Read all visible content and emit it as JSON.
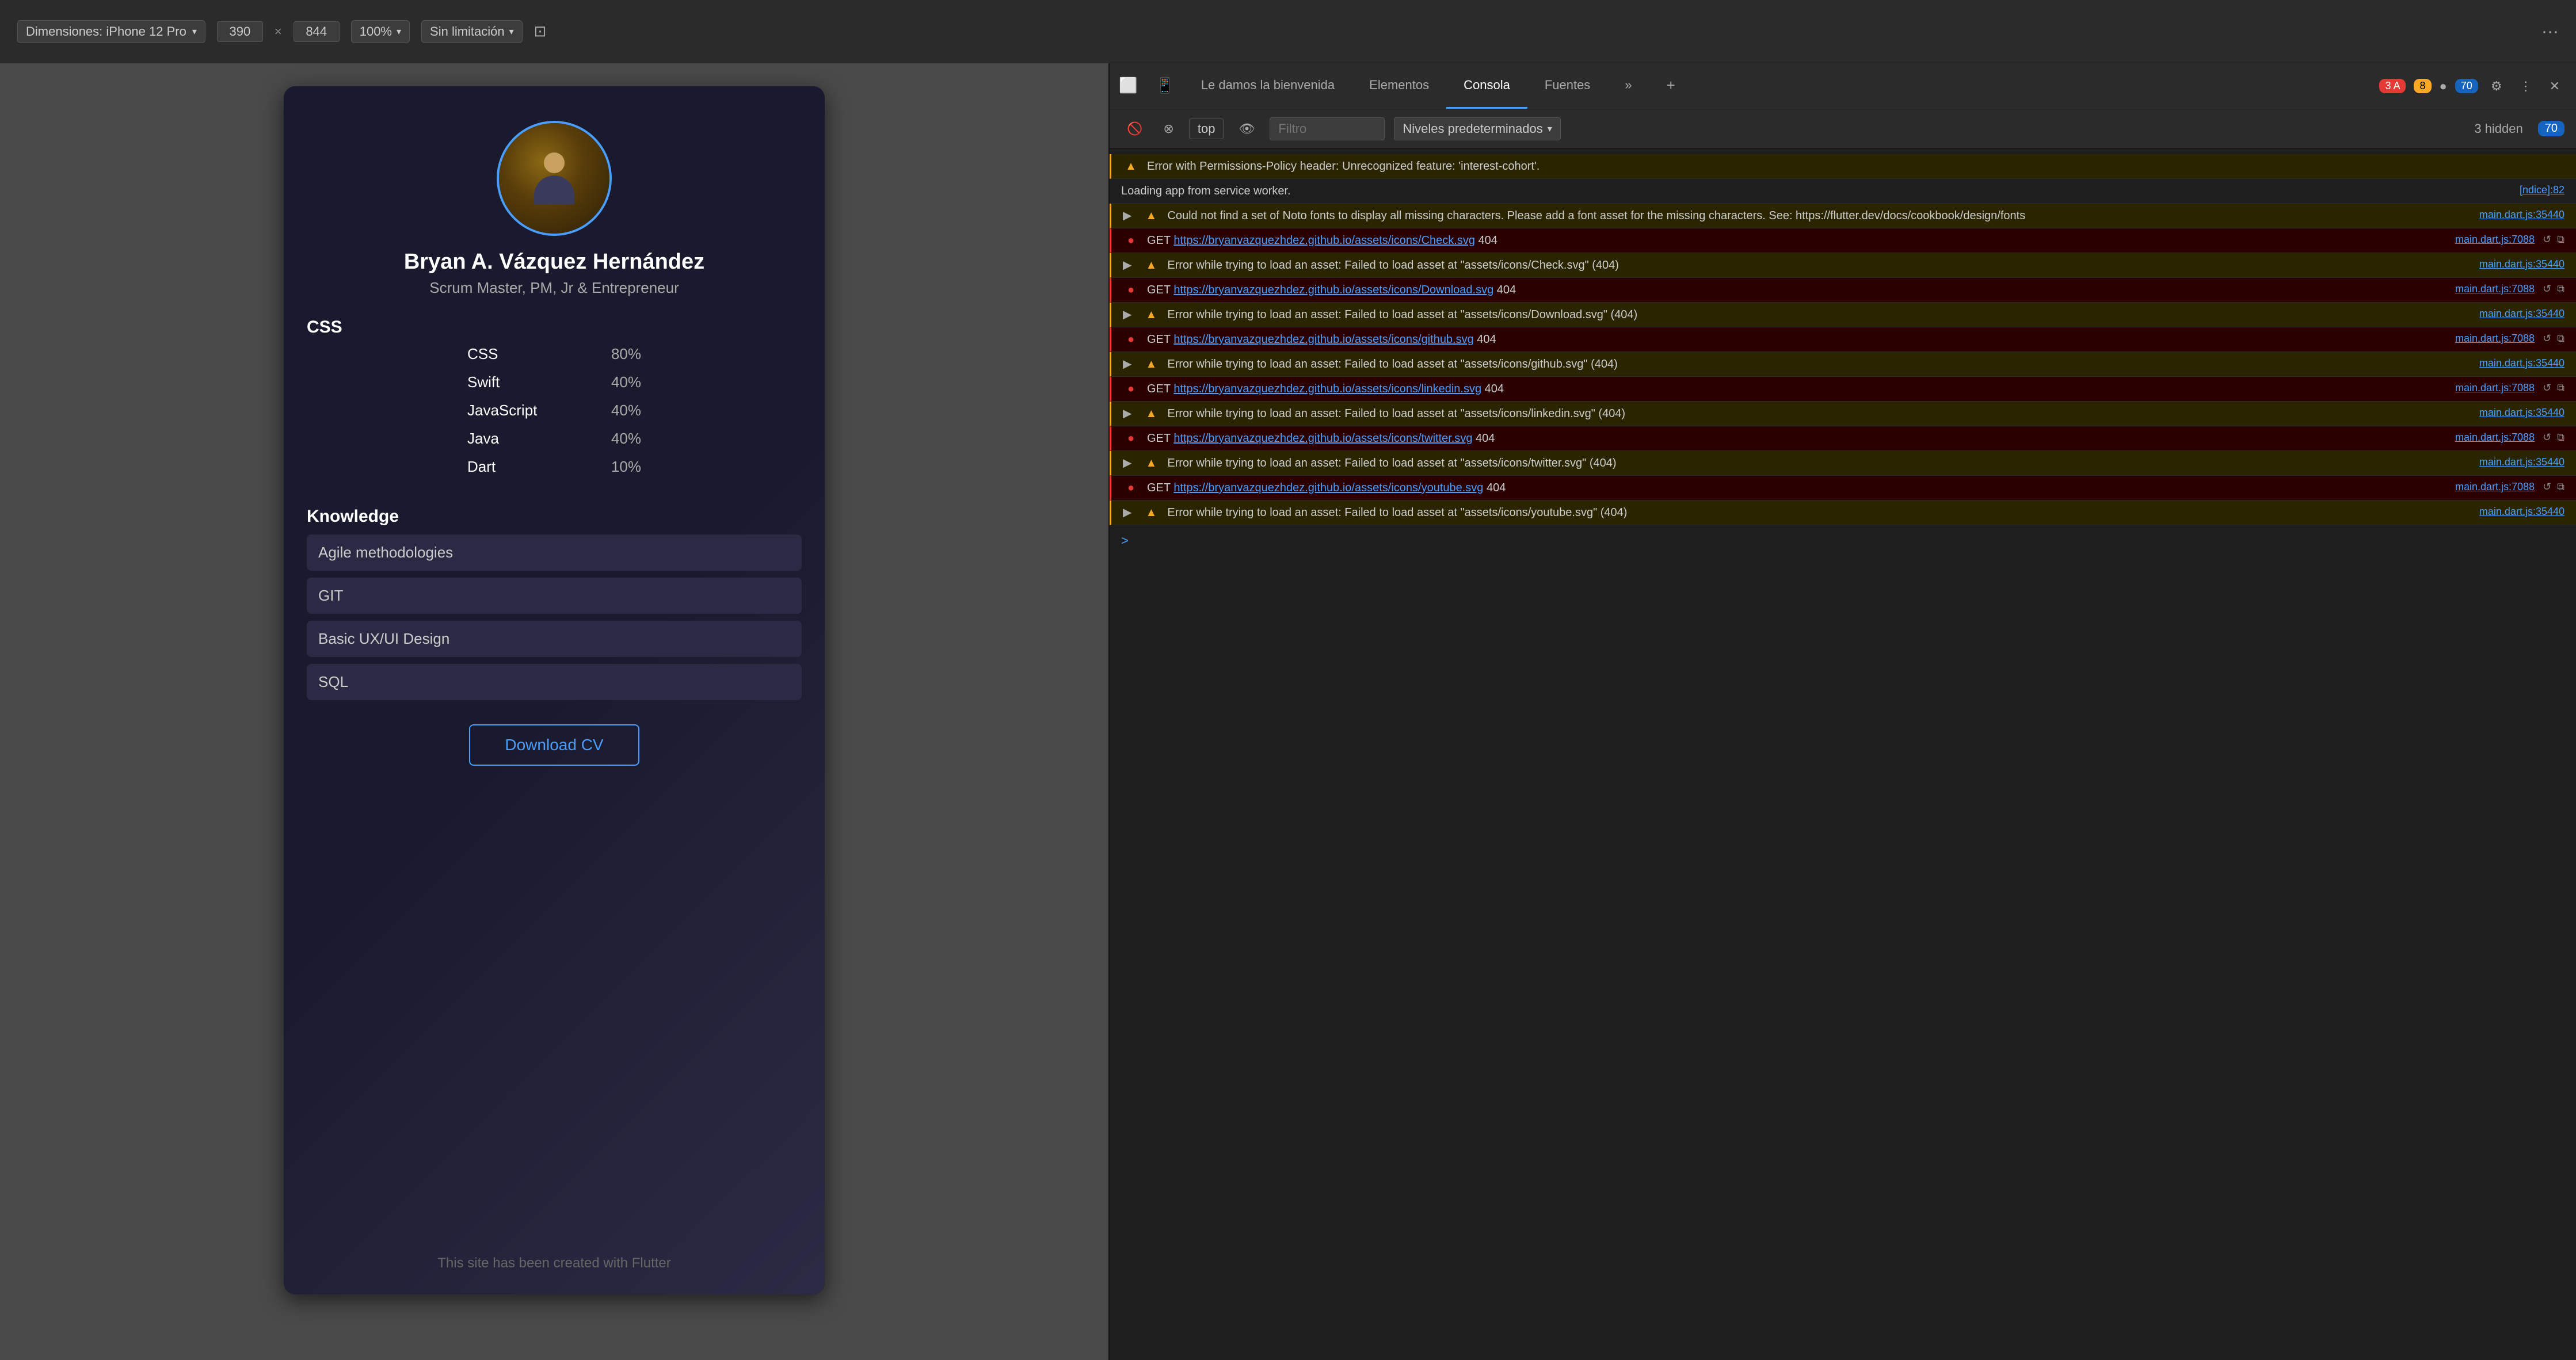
{
  "browser": {
    "toolbar": {
      "device_label": "Dimensiones: iPhone 12 Pro",
      "width_value": "390",
      "height_value": "844",
      "zoom_value": "100%",
      "limit_label": "Sin limitación",
      "more_btn": "···"
    }
  },
  "devtools": {
    "tabs": [
      {
        "id": "welcome",
        "label": "Le damos la bienvenida",
        "active": false
      },
      {
        "id": "elements",
        "label": "Elementos",
        "active": false
      },
      {
        "id": "console",
        "label": "Consola",
        "active": true
      },
      {
        "id": "sources",
        "label": "Fuentes",
        "active": false
      }
    ],
    "toolbar_icons": {
      "badge_red_count": "3",
      "badge_red_letter": "A",
      "badge_yellow_count": "8",
      "badge_total": "70",
      "settings_label": "⚙",
      "more_label": "⋮",
      "close_label": "✕"
    },
    "subtoolbar": {
      "top_value": "top",
      "filter_placeholder": "Filtro",
      "level_label": "Niveles predeterminados",
      "hidden_label": "3 hidden",
      "count_badge": "70"
    },
    "console_entries": [
      {
        "id": 1,
        "type": "warning",
        "icon": "▲",
        "text": "Error with Permissions-Policy header: Unrecognized feature: 'interest-cohort'.",
        "source": null,
        "source_line": null
      },
      {
        "id": 2,
        "type": "info",
        "icon": "",
        "text": "Loading app from service worker.",
        "source": "[ndice]:82",
        "source_line": null
      },
      {
        "id": 3,
        "type": "warning",
        "icon": "▶▲",
        "text": "Could not find a set of Noto fonts to display all missing characters. Please add a font asset for the missing characters. See: https://flutter.dev/docs/cookbook/design/fonts",
        "source": "main.dart.js:35440",
        "source_line": null
      },
      {
        "id": 4,
        "type": "error",
        "icon": "●",
        "text": "GET https://bryanvazquezhdez.github.io/assets/icons/Check.svg 404",
        "source": "main.dart.js:7088",
        "link_text": "https://bryanvazquezhdez.github.io/assets/icons/Check.svg"
      },
      {
        "id": 5,
        "type": "warning",
        "icon": "▶▲",
        "text": "Error while trying to load an asset: Failed to load asset at \"assets/icons/Check.svg\" (404)",
        "source": "main.dart.js:35440"
      },
      {
        "id": 6,
        "type": "error",
        "icon": "●",
        "text": "GET https://bryanvazquezhdez.github.io/assets/icons/Download.svg 404",
        "source": "main.dart.js:7088",
        "link_text": "https://bryanvazquezhdez.github.io/assets/icons/Download.svg"
      },
      {
        "id": 7,
        "type": "warning",
        "icon": "▶▲",
        "text": "Error while trying to load an asset: Failed to load asset at \"assets/icons/Download.svg\" (404)",
        "source": "main.dart.js:35440"
      },
      {
        "id": 8,
        "type": "error",
        "icon": "●",
        "text": "GET https://bryanvazquezhdez.github.io/assets/icons/github.svg 404",
        "source": "main.dart.js:7088",
        "link_text": "https://bryanvazquezhdez.github.io/assets/icons/github.svg"
      },
      {
        "id": 9,
        "type": "warning",
        "icon": "▶▲",
        "text": "Error while trying to load an asset: Failed to load asset at \"assets/icons/github.svg\" (404)",
        "source": "main.dart.js:35440"
      },
      {
        "id": 10,
        "type": "error",
        "icon": "●",
        "text": "GET https://bryanvazquezhdez.github.io/assets/icons/linkedin.svg 404",
        "source": "main.dart.js:7088",
        "link_text": "https://bryanvazquezhdez.github.io/assets/icons/linkedin.svg"
      },
      {
        "id": 11,
        "type": "warning",
        "icon": "▶▲",
        "text": "Error while trying to load an asset: Failed to load asset at \"assets/icons/linkedin.svg\" (404)",
        "source": "main.dart.js:35440"
      },
      {
        "id": 12,
        "type": "error",
        "icon": "●",
        "text": "GET https://bryanvazquezhdez.github.io/assets/icons/twitter.svg 404",
        "source": "main.dart.js:7088",
        "link_text": "https://bryanvazquezhdez.github.io/assets/icons/twitter.svg"
      },
      {
        "id": 13,
        "type": "warning",
        "icon": "▶▲",
        "text": "Error while trying to load an asset: Failed to load asset at \"assets/icons/twitter.svg\" (404)",
        "source": "main.dart.js:35440"
      },
      {
        "id": 14,
        "type": "error",
        "icon": "●",
        "text": "GET https://bryanvazquezhdez.github.io/assets/icons/youtube.svg 404",
        "source": "main.dart.js:7088",
        "link_text": "https://bryanvazquezhdez.github.io/assets/icons/youtube.svg"
      },
      {
        "id": 15,
        "type": "warning",
        "icon": "▶▲",
        "text": "Error while trying to load an asset: Failed to load asset at \"assets/icons/youtube.svg\" (404)",
        "source": "main.dart.js:35440"
      }
    ],
    "prompt": ">"
  },
  "profile": {
    "name": "Bryan A. Vázquez Hernández",
    "title": "Scrum Master, PM, Jr & Entrepreneur",
    "skills": [
      {
        "name": "CSS",
        "pct": 80,
        "label": "80%"
      },
      {
        "name": "Swift",
        "pct": 40,
        "label": "40%"
      },
      {
        "name": "JavaScript",
        "pct": 40,
        "label": "40%"
      },
      {
        "name": "Java",
        "pct": 40,
        "label": "40%"
      },
      {
        "name": "Dart",
        "pct": 10,
        "label": "10%"
      }
    ],
    "knowledge_title": "Knowledge",
    "knowledge_items": [
      "Agile methodologies",
      "GIT",
      "Basic UX/UI Design",
      "SQL"
    ],
    "download_btn": "Download CV",
    "footer": "This site has been created with Flutter"
  }
}
